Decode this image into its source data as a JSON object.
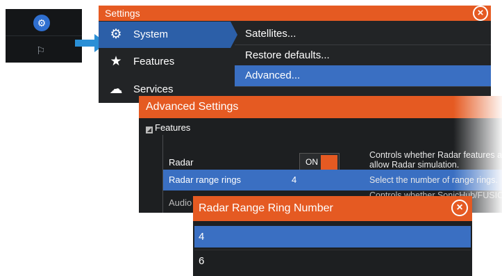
{
  "settings": {
    "title": "Settings",
    "nav": [
      {
        "label": "System",
        "icon": "gear-icon"
      },
      {
        "label": "Features",
        "icon": "star-icon"
      },
      {
        "label": "Services",
        "icon": "cloud-icon"
      }
    ],
    "submenu": [
      "Satellites...",
      "Restore defaults...",
      "Advanced..."
    ]
  },
  "advanced": {
    "title": "Advanced Settings",
    "tree_header": "Features",
    "rows": {
      "radar": {
        "name": "Radar",
        "toggle": "ON",
        "desc": "Controls whether Radar features are sho\nallow Radar simulation."
      },
      "rings": {
        "name": "Radar range rings",
        "value": "4",
        "desc": "Select the number of range rings."
      },
      "audio": {
        "name": "Audio",
        "desc": "Controls whether SonicHub/FUSION-Link"
      }
    }
  },
  "dialog": {
    "title": "Radar Range Ring Number",
    "options": [
      "4",
      "6"
    ],
    "selected": "4"
  },
  "colors": {
    "accent": "#e55a22",
    "selection": "#3a6fc2",
    "panel": "#1d1f21"
  }
}
